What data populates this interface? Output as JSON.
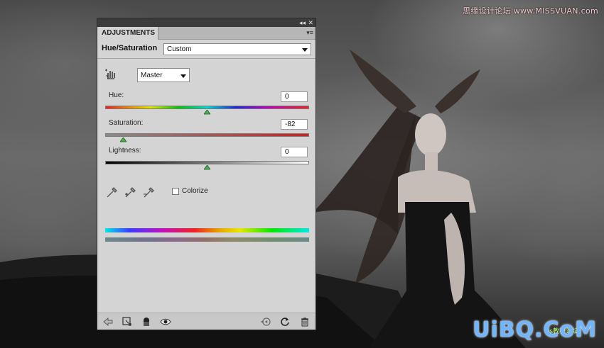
{
  "panel": {
    "tab_label": "ADJUSTMENTS",
    "title": "Hue/Saturation",
    "preset": {
      "selected": "Custom"
    },
    "channel": {
      "selected": "Master"
    },
    "hue": {
      "label": "Hue:",
      "value": "0",
      "slider_fraction": 0.5
    },
    "saturation": {
      "label": "Saturation:",
      "value": "-82",
      "slider_fraction": 0.09
    },
    "lightness": {
      "label": "Lightness:",
      "value": "0",
      "slider_fraction": 0.5
    },
    "colorize": {
      "label": "Colorize",
      "checked": false
    }
  },
  "watermarks": {
    "top": "思缘设计论坛 www.MISSVUAN.com",
    "bottom": "UiBQ.CoM",
    "bottom_sub": "ps教程论坛"
  },
  "colors": {
    "panel_bg": "#d4d4d4",
    "watermark_blue": "#6fb6ff"
  }
}
